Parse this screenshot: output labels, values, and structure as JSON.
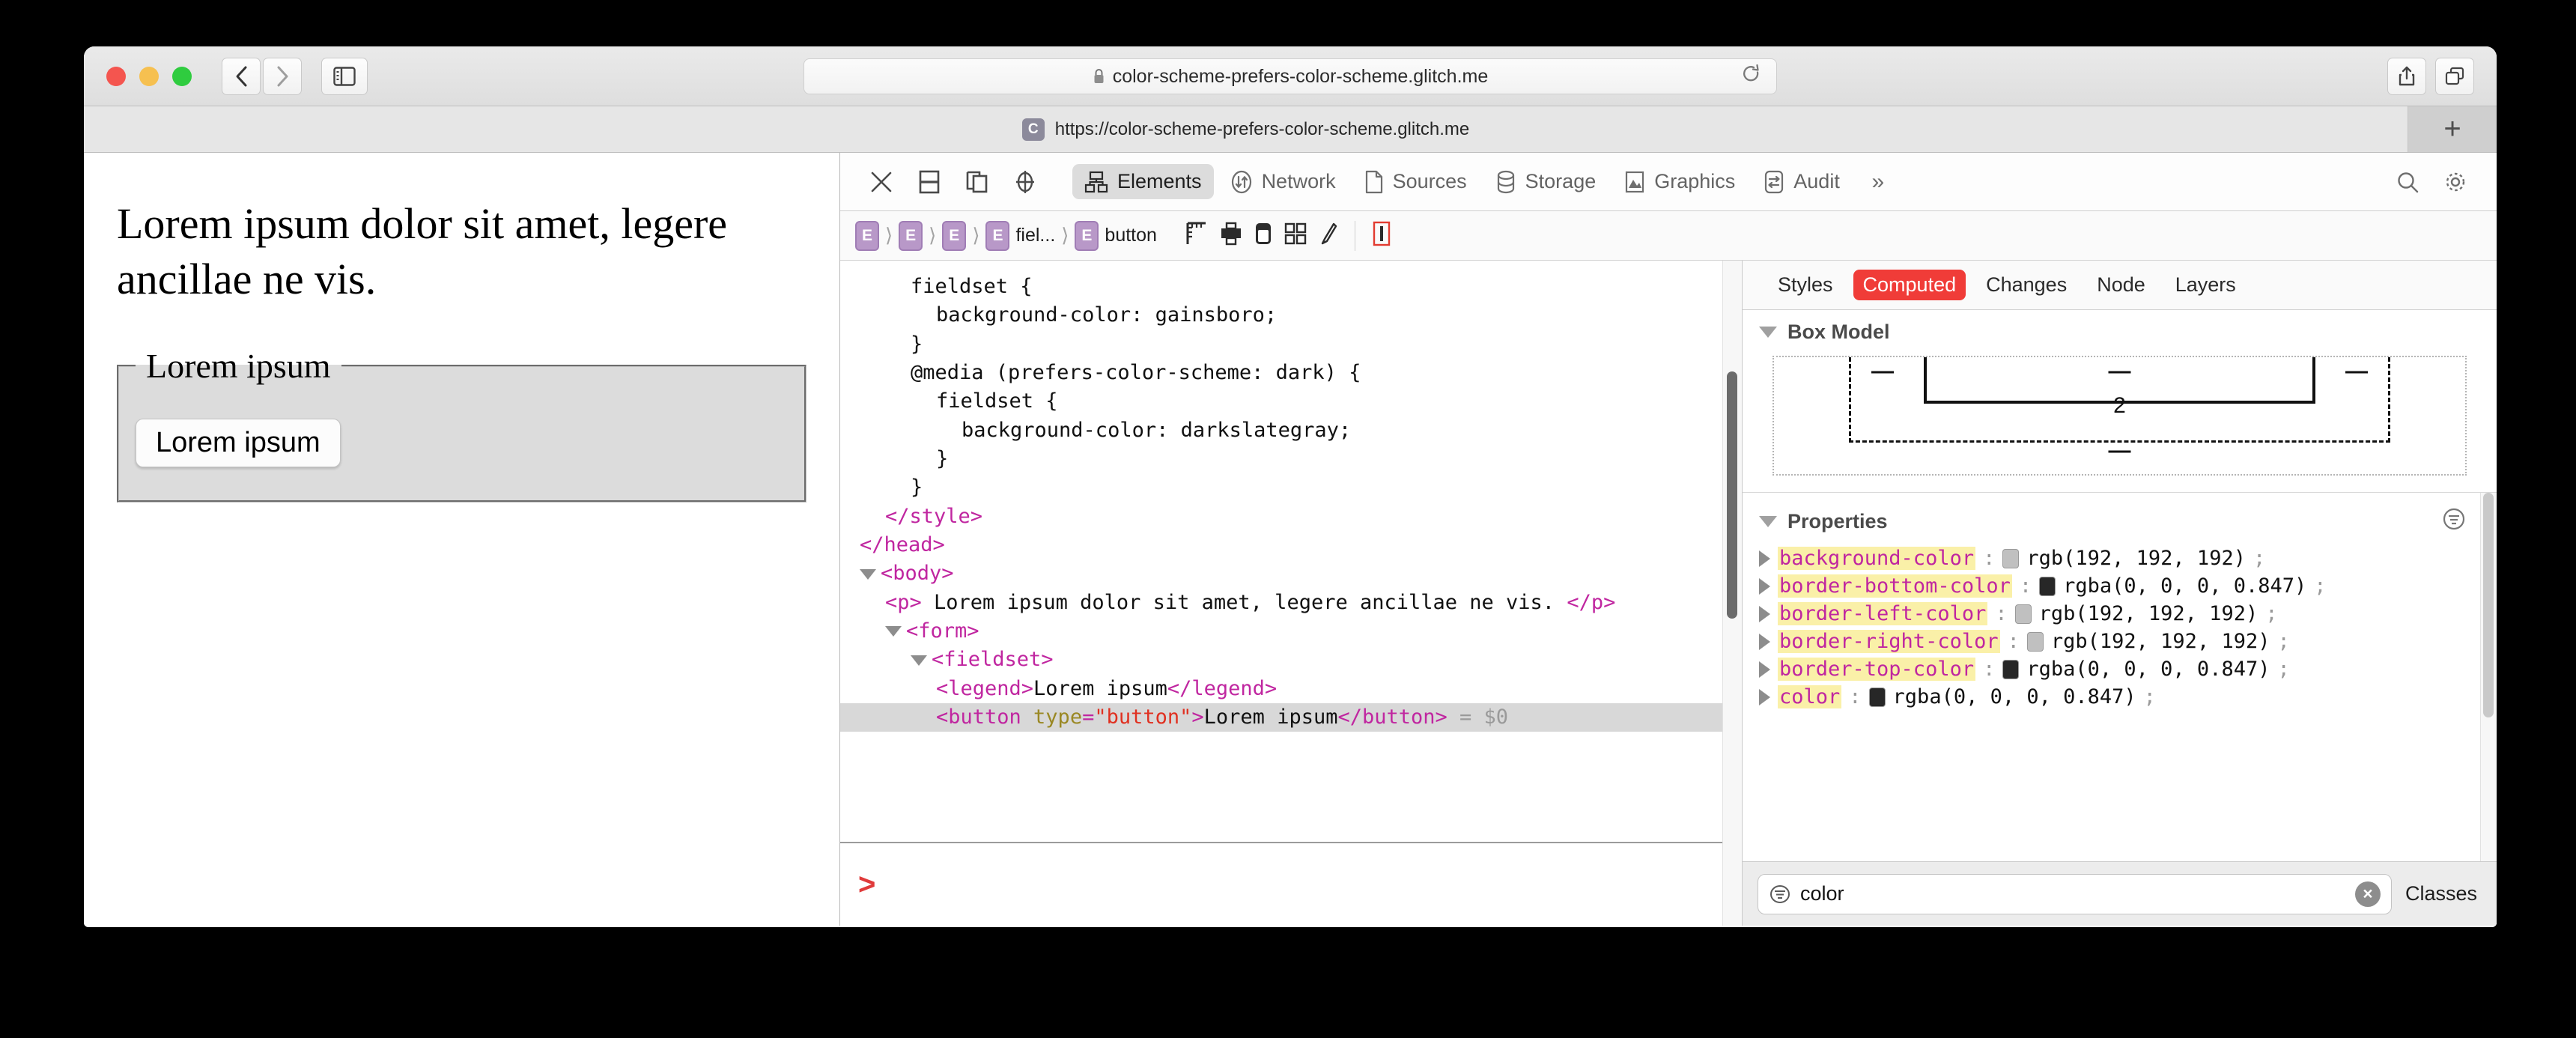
{
  "browser": {
    "url": "color-scheme-prefers-color-scheme.glitch.me",
    "lock_icon": "lock-icon",
    "reload_icon": "reload-icon",
    "back_icon": "back-chevron-icon",
    "forward_icon": "forward-chevron-icon",
    "sidebar_icon": "sidebar-toggle-icon",
    "share_icon": "share-icon",
    "tabs_overview_icon": "tab-overview-icon",
    "new_tab_label": "+",
    "tab": {
      "favicon_letter": "C",
      "title": "https://color-scheme-prefers-color-scheme.glitch.me"
    }
  },
  "page": {
    "paragraph": "Lorem ipsum dolor sit amet, legere ancillae ne vis.",
    "legend": "Lorem ipsum",
    "button_label": "Lorem ipsum"
  },
  "inspector": {
    "toolbar_icons": [
      {
        "name": "close-icon"
      },
      {
        "name": "dock-bottom-icon"
      },
      {
        "name": "dock-separate-window-icon"
      },
      {
        "name": "inspect-element-icon"
      }
    ],
    "panels": [
      {
        "label": "Elements",
        "icon": "elements-tree-icon",
        "active": true
      },
      {
        "label": "Network",
        "icon": "network-arrows-icon",
        "active": false
      },
      {
        "label": "Sources",
        "icon": "sources-page-icon",
        "active": false
      },
      {
        "label": "Storage",
        "icon": "storage-database-icon",
        "active": false
      },
      {
        "label": "Graphics",
        "icon": "graphics-image-icon",
        "active": false
      },
      {
        "label": "Audit",
        "icon": "audit-swap-icon",
        "active": false
      }
    ],
    "overflow_label": "»",
    "search_icon": "search-icon",
    "settings_icon": "gear-icon",
    "breadcrumb": [
      {
        "badge": "E",
        "label": ""
      },
      {
        "badge": "E",
        "label": ""
      },
      {
        "badge": "E",
        "label": ""
      },
      {
        "badge": "E",
        "label": "fiel..."
      },
      {
        "badge": "E",
        "label": "button"
      }
    ],
    "breadcrumb_tools": [
      {
        "name": "layout-ruler-icon"
      },
      {
        "name": "print-icon"
      },
      {
        "name": "device-icon"
      },
      {
        "name": "grid-overlay-icon"
      },
      {
        "name": "paint-brush-icon"
      },
      {
        "name": "visual-styles-icon"
      }
    ],
    "code_lines": [
      {
        "indent": 2,
        "parts": [
          {
            "t": "txt",
            "s": "fieldset {"
          }
        ]
      },
      {
        "indent": 3,
        "parts": [
          {
            "t": "txt",
            "s": "background-color: gainsboro;"
          }
        ]
      },
      {
        "indent": 2,
        "parts": [
          {
            "t": "txt",
            "s": "}"
          }
        ]
      },
      {
        "indent": 2,
        "parts": [
          {
            "t": "txt",
            "s": "@media (prefers-color-scheme: dark) {"
          }
        ]
      },
      {
        "indent": 3,
        "parts": [
          {
            "t": "txt",
            "s": "fieldset {"
          }
        ]
      },
      {
        "indent": 4,
        "parts": [
          {
            "t": "txt",
            "s": "background-color: darkslategray;"
          }
        ]
      },
      {
        "indent": 3,
        "parts": [
          {
            "t": "txt",
            "s": "}"
          }
        ]
      },
      {
        "indent": 2,
        "parts": [
          {
            "t": "txt",
            "s": "}"
          }
        ]
      },
      {
        "indent": 1,
        "parts": [
          {
            "t": "tagname",
            "s": "</style>"
          }
        ]
      },
      {
        "indent": 0,
        "parts": [
          {
            "t": "tagname",
            "s": "</head>"
          }
        ]
      },
      {
        "indent": 0,
        "arrow": true,
        "parts": [
          {
            "t": "tagname",
            "s": "<body>"
          }
        ]
      },
      {
        "indent": 1,
        "parts": [
          {
            "t": "tagname",
            "s": "<p>"
          },
          {
            "t": "txt",
            "s": " Lorem ipsum dolor sit amet, legere ancillae ne vis. "
          },
          {
            "t": "tagname",
            "s": "</p>"
          }
        ]
      },
      {
        "indent": 1,
        "arrow": true,
        "parts": [
          {
            "t": "tagname",
            "s": "<form>"
          }
        ]
      },
      {
        "indent": 2,
        "arrow": true,
        "parts": [
          {
            "t": "tagname",
            "s": "<fieldset>"
          }
        ]
      },
      {
        "indent": 3,
        "parts": [
          {
            "t": "tagname",
            "s": "<legend>"
          },
          {
            "t": "txt",
            "s": "Lorem ipsum"
          },
          {
            "t": "tagname",
            "s": "</legend>"
          }
        ]
      },
      {
        "indent": 3,
        "selected": true,
        "parts": [
          {
            "t": "tagname",
            "s": "<button "
          },
          {
            "t": "attrname",
            "s": "type"
          },
          {
            "t": "tagname",
            "s": "="
          },
          {
            "t": "attrval",
            "s": "\"button\""
          },
          {
            "t": "tagname",
            "s": ">"
          },
          {
            "t": "txt",
            "s": "Lorem ipsum"
          },
          {
            "t": "tagname",
            "s": "</button>"
          },
          {
            "t": "muted",
            "s": " = $0"
          }
        ]
      }
    ],
    "console_prompt": ">"
  },
  "sidebar": {
    "tabs": [
      {
        "label": "Styles",
        "active": false
      },
      {
        "label": "Computed",
        "active": true
      },
      {
        "label": "Changes",
        "active": false
      },
      {
        "label": "Node",
        "active": false
      },
      {
        "label": "Layers",
        "active": false
      }
    ],
    "box_model": {
      "title": "Box Model",
      "margin_top": "—",
      "margin_center": "—",
      "margin_right": "—",
      "padding_value": "2",
      "bottom_value": "—"
    },
    "properties_title": "Properties",
    "properties_menu_icon": "properties-options-icon",
    "properties": [
      {
        "name": "background-color",
        "swatch": "#c0c0c0",
        "value": "rgb(192, 192, 192)"
      },
      {
        "name": "border-bottom-color",
        "swatch": "rgba(0,0,0,0.847)",
        "value": "rgba(0, 0, 0, 0.847)"
      },
      {
        "name": "border-left-color",
        "swatch": "#c0c0c0",
        "value": "rgb(192, 192, 192)"
      },
      {
        "name": "border-right-color",
        "swatch": "#c0c0c0",
        "value": "rgb(192, 192, 192)"
      },
      {
        "name": "border-top-color",
        "swatch": "rgba(0,0,0,0.847)",
        "value": "rgba(0, 0, 0, 0.847)"
      },
      {
        "name": "color",
        "swatch": "rgba(0,0,0,0.847)",
        "value": "rgba(0, 0, 0, 0.847)"
      }
    ],
    "filter": {
      "value": "color",
      "icon": "filter-icon",
      "clear_label": "×"
    },
    "classes_label": "Classes"
  }
}
